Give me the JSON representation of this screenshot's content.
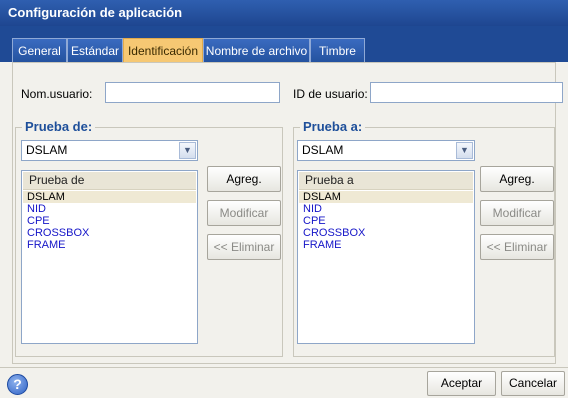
{
  "window": {
    "title": "Configuración de aplicación"
  },
  "tabs": [
    {
      "label": "General",
      "active": false
    },
    {
      "label": "Estándar",
      "active": false
    },
    {
      "label": "Identificación",
      "active": true
    },
    {
      "label": "Nombre de archivo",
      "active": false
    },
    {
      "label": "Timbre",
      "active": false
    }
  ],
  "fields": {
    "username_label": "Nom.usuario:",
    "username_value": "",
    "userid_label": "ID de usuario:",
    "userid_value": ""
  },
  "test_from": {
    "title": "Prueba de:",
    "selected": "DSLAM",
    "list_header": "Prueba de",
    "items": [
      "DSLAM",
      "NID",
      "CPE",
      "CROSSBOX",
      "FRAME"
    ],
    "selected_index": 0,
    "add_label": "Agreg.",
    "modify_label": "Modificar",
    "remove_label": "<< Eliminar"
  },
  "test_to": {
    "title": "Prueba a:",
    "selected": "DSLAM",
    "list_header": "Prueba a",
    "items": [
      "DSLAM",
      "NID",
      "CPE",
      "CROSSBOX",
      "FRAME"
    ],
    "selected_index": 0,
    "add_label": "Agreg.",
    "modify_label": "Modificar",
    "remove_label": "<< Eliminar"
  },
  "footer": {
    "help_glyph": "?",
    "accept_label": "Aceptar",
    "cancel_label": "Cancelar"
  },
  "icons": {
    "help": "help-icon",
    "dropdown": "chevron-down-icon"
  }
}
